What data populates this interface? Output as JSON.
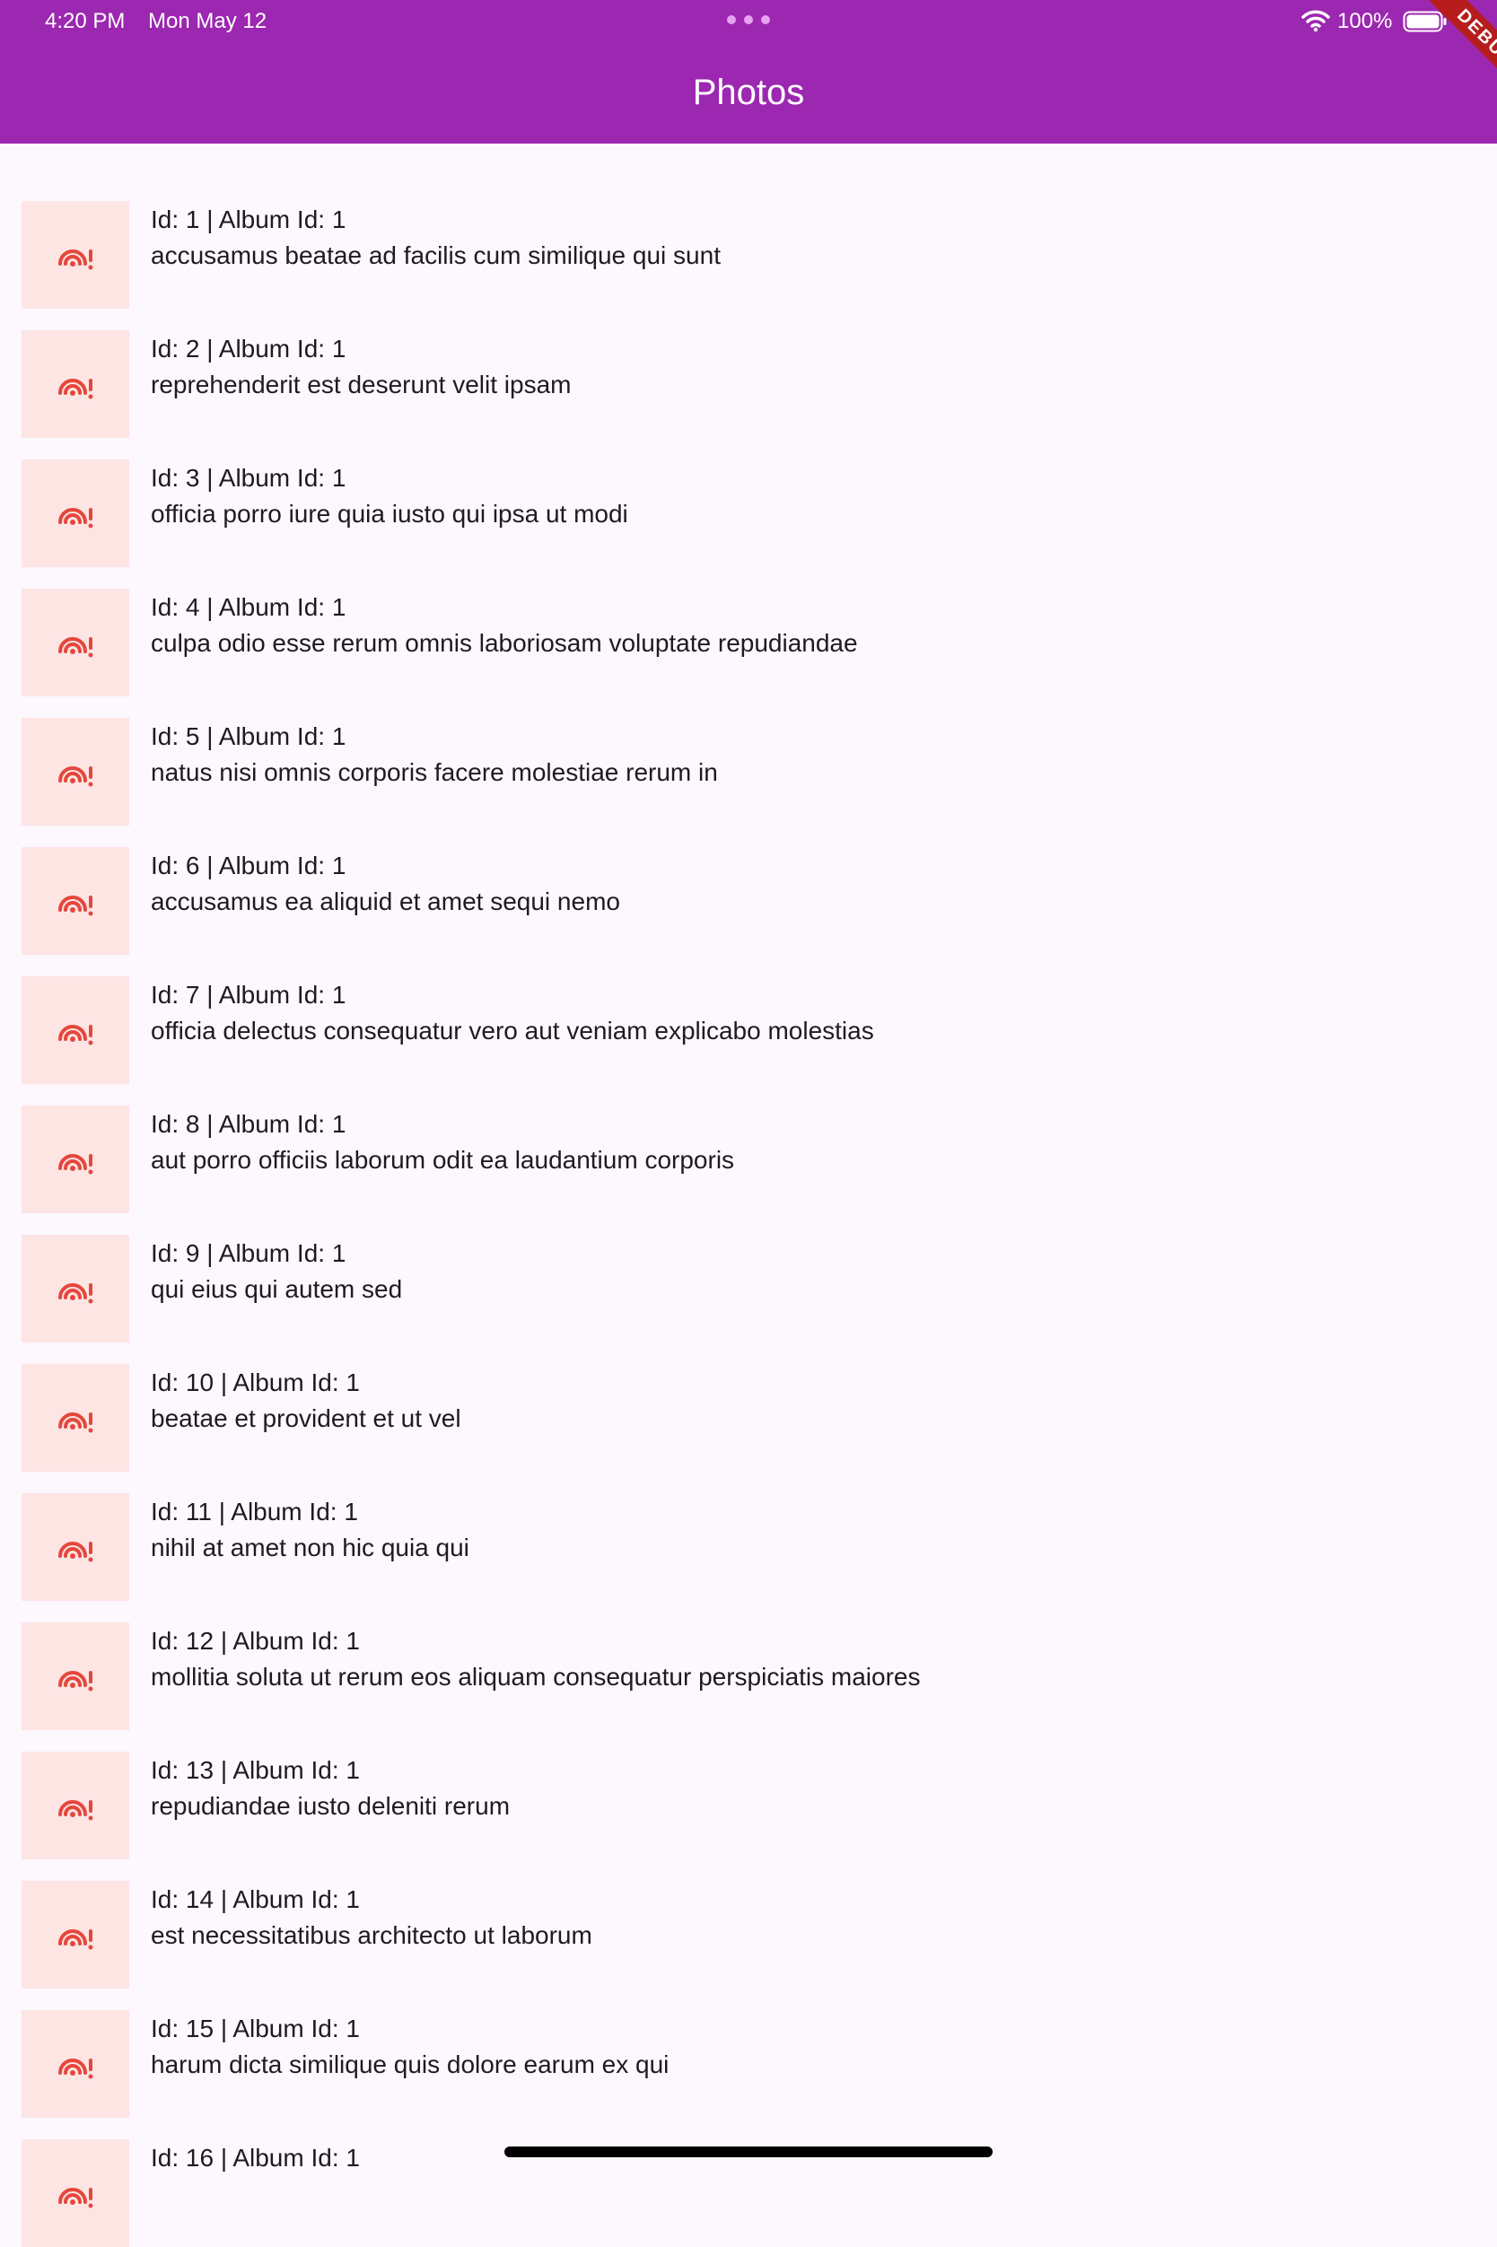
{
  "status_bar": {
    "time": "4:20 PM",
    "date": "Mon May 12",
    "battery": "100%"
  },
  "app_bar": {
    "title": "Photos",
    "color": "#9C27B0"
  },
  "debug_banner": "DEBUG",
  "photos": [
    {
      "meta": "Id: 1 | Album Id: 1",
      "title": "accusamus beatae ad facilis cum similique qui sunt"
    },
    {
      "meta": "Id: 2 | Album Id: 1",
      "title": "reprehenderit est deserunt velit ipsam"
    },
    {
      "meta": "Id: 3 | Album Id: 1",
      "title": "officia porro iure quia iusto qui ipsa ut modi"
    },
    {
      "meta": "Id: 4 | Album Id: 1",
      "title": "culpa odio esse rerum omnis laboriosam voluptate repudiandae"
    },
    {
      "meta": "Id: 5 | Album Id: 1",
      "title": "natus nisi omnis corporis facere molestiae rerum in"
    },
    {
      "meta": "Id: 6 | Album Id: 1",
      "title": "accusamus ea aliquid et amet sequi nemo"
    },
    {
      "meta": "Id: 7 | Album Id: 1",
      "title": "officia delectus consequatur vero aut veniam explicabo molestias"
    },
    {
      "meta": "Id: 8 | Album Id: 1",
      "title": "aut porro officiis laborum odit ea laudantium corporis"
    },
    {
      "meta": "Id: 9 | Album Id: 1",
      "title": "qui eius qui autem sed"
    },
    {
      "meta": "Id: 10 | Album Id: 1",
      "title": "beatae et provident et ut vel"
    },
    {
      "meta": "Id: 11 | Album Id: 1",
      "title": "nihil at amet non hic quia qui"
    },
    {
      "meta": "Id: 12 | Album Id: 1",
      "title": "mollitia soluta ut rerum eos aliquam consequatur perspiciatis maiores"
    },
    {
      "meta": "Id: 13 | Album Id: 1",
      "title": "repudiandae iusto deleniti rerum"
    },
    {
      "meta": "Id: 14 | Album Id: 1",
      "title": "est necessitatibus architecto ut laborum"
    },
    {
      "meta": "Id: 15 | Album Id: 1",
      "title": "harum dicta similique quis dolore earum ex qui"
    },
    {
      "meta": "Id: 16 | Album Id: 1",
      "title": ""
    }
  ],
  "thumbnail_icon": "broken-image-icon",
  "colors": {
    "thumb_bg": "#FDE5E4",
    "icon": "#E5473C",
    "page_bg": "#FDF7FE"
  }
}
